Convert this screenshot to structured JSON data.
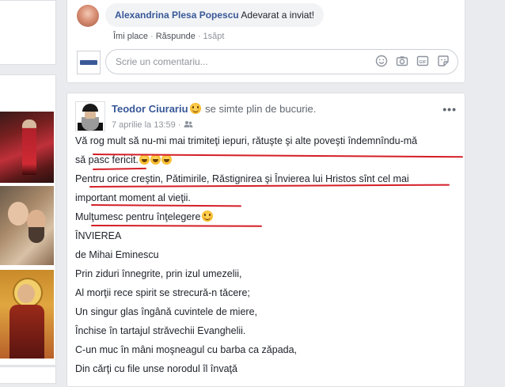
{
  "comment": {
    "author": "Alexandrina Plesa Popescu",
    "text": "Adevarat a inviat!",
    "like_label": "Îmi place",
    "reply_label": "Răspunde",
    "time": "1săpt",
    "separator": "·"
  },
  "composer": {
    "placeholder": "Scrie un comentariu...",
    "icons": [
      "smiley-icon",
      "camera-icon",
      "gif-icon",
      "sticker-icon"
    ]
  },
  "post": {
    "author": "Teodor Ciurariu",
    "feeling": "se simte plin de bucurie.",
    "date": "7 aprilie la 13:59",
    "separator": "·",
    "audience_icon": "friends-icon",
    "more_icon": "•••",
    "lines": [
      "Vă rog mult să nu-mi mai trimiteţi iepuri, rǎtuşte şi alte poveşti îndemnîndu-mǎ",
      "sǎ pasc fericit.",
      "Pentru orice creştin, Pǎtimirile, Rǎstignirea şi Învierea lui Hristos sînt cel mai",
      "important moment al vieţii.",
      "Mulţumesc pentru înţelegere",
      "ÎNVIEREA",
      "de Mihai Eminescu",
      "Prin ziduri înnegrite, prin izul umezelii,",
      "Al morţii rece spirit se strecurǎ-n tǎcere;",
      "Un singur glas îngânǎ cuvintele de miere,",
      "Închise în tartajul strǎvechii Evanghelii.",
      "C-un muc în mâni moşneagul cu barba ca zǎpada,",
      "Din cǎrţi cu file unse norodul îl învaţǎ"
    ]
  },
  "colors": {
    "link": "#385898",
    "underline": "#d41f27",
    "background": "#e9ebee"
  }
}
